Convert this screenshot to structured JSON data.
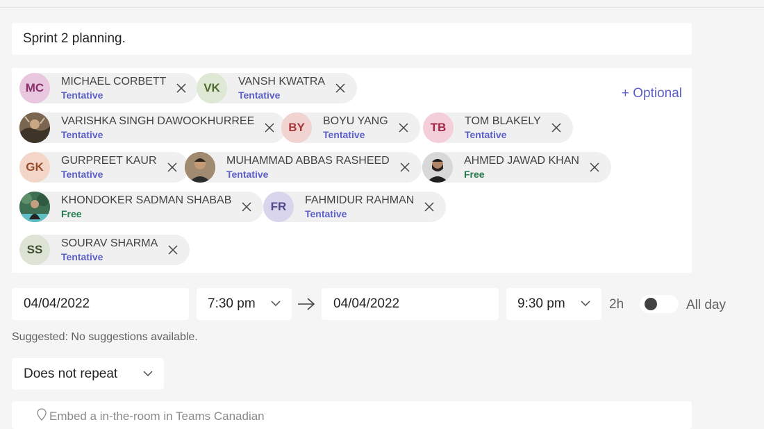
{
  "meeting": {
    "title": "Sprint 2 planning."
  },
  "attendees": {
    "optional_label": "+ Optional",
    "list": [
      {
        "initials": "MC",
        "name": "MICHAEL CORBETT",
        "status": "Tentative"
      },
      {
        "initials": "VK",
        "name": "VANSH KWATRA",
        "status": "Tentative"
      },
      {
        "initials": "",
        "name": "VARISHKA SINGH DAWOOKHURREE",
        "status": "Tentative"
      },
      {
        "initials": "BY",
        "name": "BOYU YANG",
        "status": "Tentative"
      },
      {
        "initials": "TB",
        "name": "TOM BLAKELY",
        "status": "Tentative"
      },
      {
        "initials": "GK",
        "name": "GURPREET KAUR",
        "status": "Tentative"
      },
      {
        "initials": "",
        "name": "MUHAMMAD ABBAS RASHEED",
        "status": "Tentative"
      },
      {
        "initials": "",
        "name": "AHMED JAWAD KHAN",
        "status": "Free"
      },
      {
        "initials": "",
        "name": "KHONDOKER SADMAN SHABAB",
        "status": "Free"
      },
      {
        "initials": "FR",
        "name": "FAHMIDUR RAHMAN",
        "status": "Tentative"
      },
      {
        "initials": "SS",
        "name": "SOURAV SHARMA",
        "status": "Tentative"
      }
    ]
  },
  "schedule": {
    "start_date": "04/04/2022",
    "start_time": "7:30 pm",
    "end_date": "04/04/2022",
    "end_time": "9:30 pm",
    "duration": "2h",
    "all_day_label": "All day",
    "all_day_enabled": false,
    "suggested": "Suggested: No suggestions available.",
    "repeat": "Does not repeat"
  },
  "location": {
    "text": "Embed a in-the-room in Teams Canadian"
  },
  "colors": {
    "accent": "#5b5fc7",
    "tentative": "#5b5fc7",
    "free": "#237b4b"
  }
}
